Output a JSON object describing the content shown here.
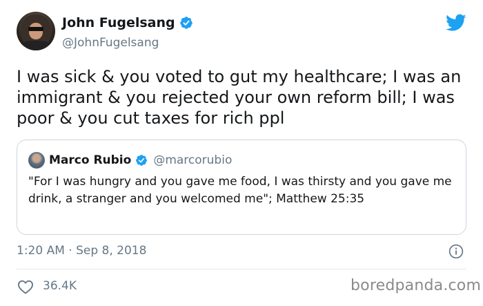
{
  "author": {
    "name": "John Fugelsang",
    "handle": "@JohnFugelsang"
  },
  "tweet": {
    "text": "I was sick & you voted to gut my healthcare; I was an immigrant & you rejected your own reform bill; I was poor & you cut taxes for rich ppl"
  },
  "quoted": {
    "name": "Marco Rubio",
    "handle": "@marcorubio",
    "text": "\"For I was hungry and you gave me food, I was thirsty and you gave me drink, a stranger and you welcomed me\"; Matthew 25:35"
  },
  "meta": {
    "timestamp": "1:20 AM · Sep 8, 2018",
    "likes": "36.4K"
  },
  "watermark": "boredpanda.com",
  "colors": {
    "twitter_blue": "#1da1f2",
    "secondary_text": "#657786",
    "border": "#ccd6dd"
  },
  "icons": [
    "verified-badge-icon",
    "twitter-bird-icon",
    "info-icon",
    "heart-icon"
  ]
}
